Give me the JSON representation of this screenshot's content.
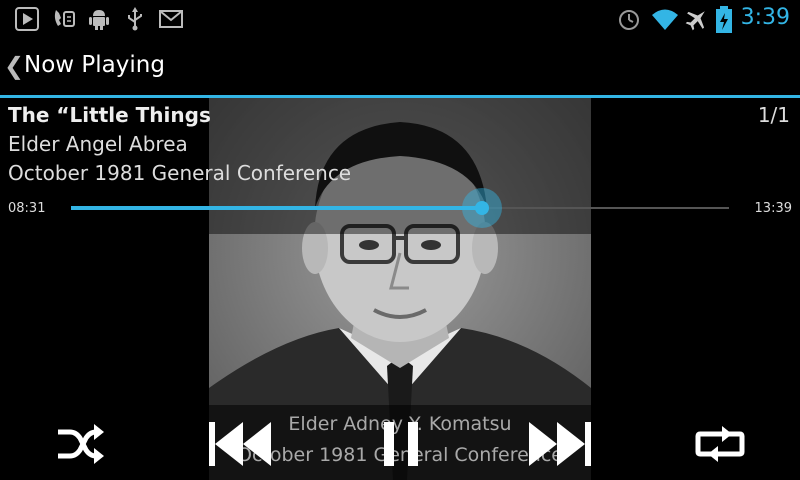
{
  "status_bar": {
    "time": "3:39",
    "icons": [
      "play-store-icon",
      "voicemail-icon",
      "android-debug-icon",
      "usb-icon",
      "gmail-icon",
      "alarm-icon",
      "wifi-icon",
      "airplane-mode-icon",
      "battery-charging-icon"
    ]
  },
  "action_bar": {
    "back_glyph": "❮",
    "title": "Now Playing"
  },
  "track": {
    "title": "The “Little Things",
    "artist": "Elder Angel Abrea",
    "album": "October 1981 General Conference",
    "position": "1/1"
  },
  "progress": {
    "elapsed": "08:31",
    "total": "13:39",
    "fraction": 0.624
  },
  "album_art": {
    "caption_speaker": "Elder Adney Y. Komatsu",
    "caption_conference": "October 1981 General Conference"
  },
  "controls": {
    "icons": [
      "shuffle-icon",
      "previous-icon",
      "pause-icon",
      "next-icon",
      "repeat-icon"
    ]
  },
  "colors": {
    "accent": "#33b5e5",
    "background": "#000000"
  }
}
